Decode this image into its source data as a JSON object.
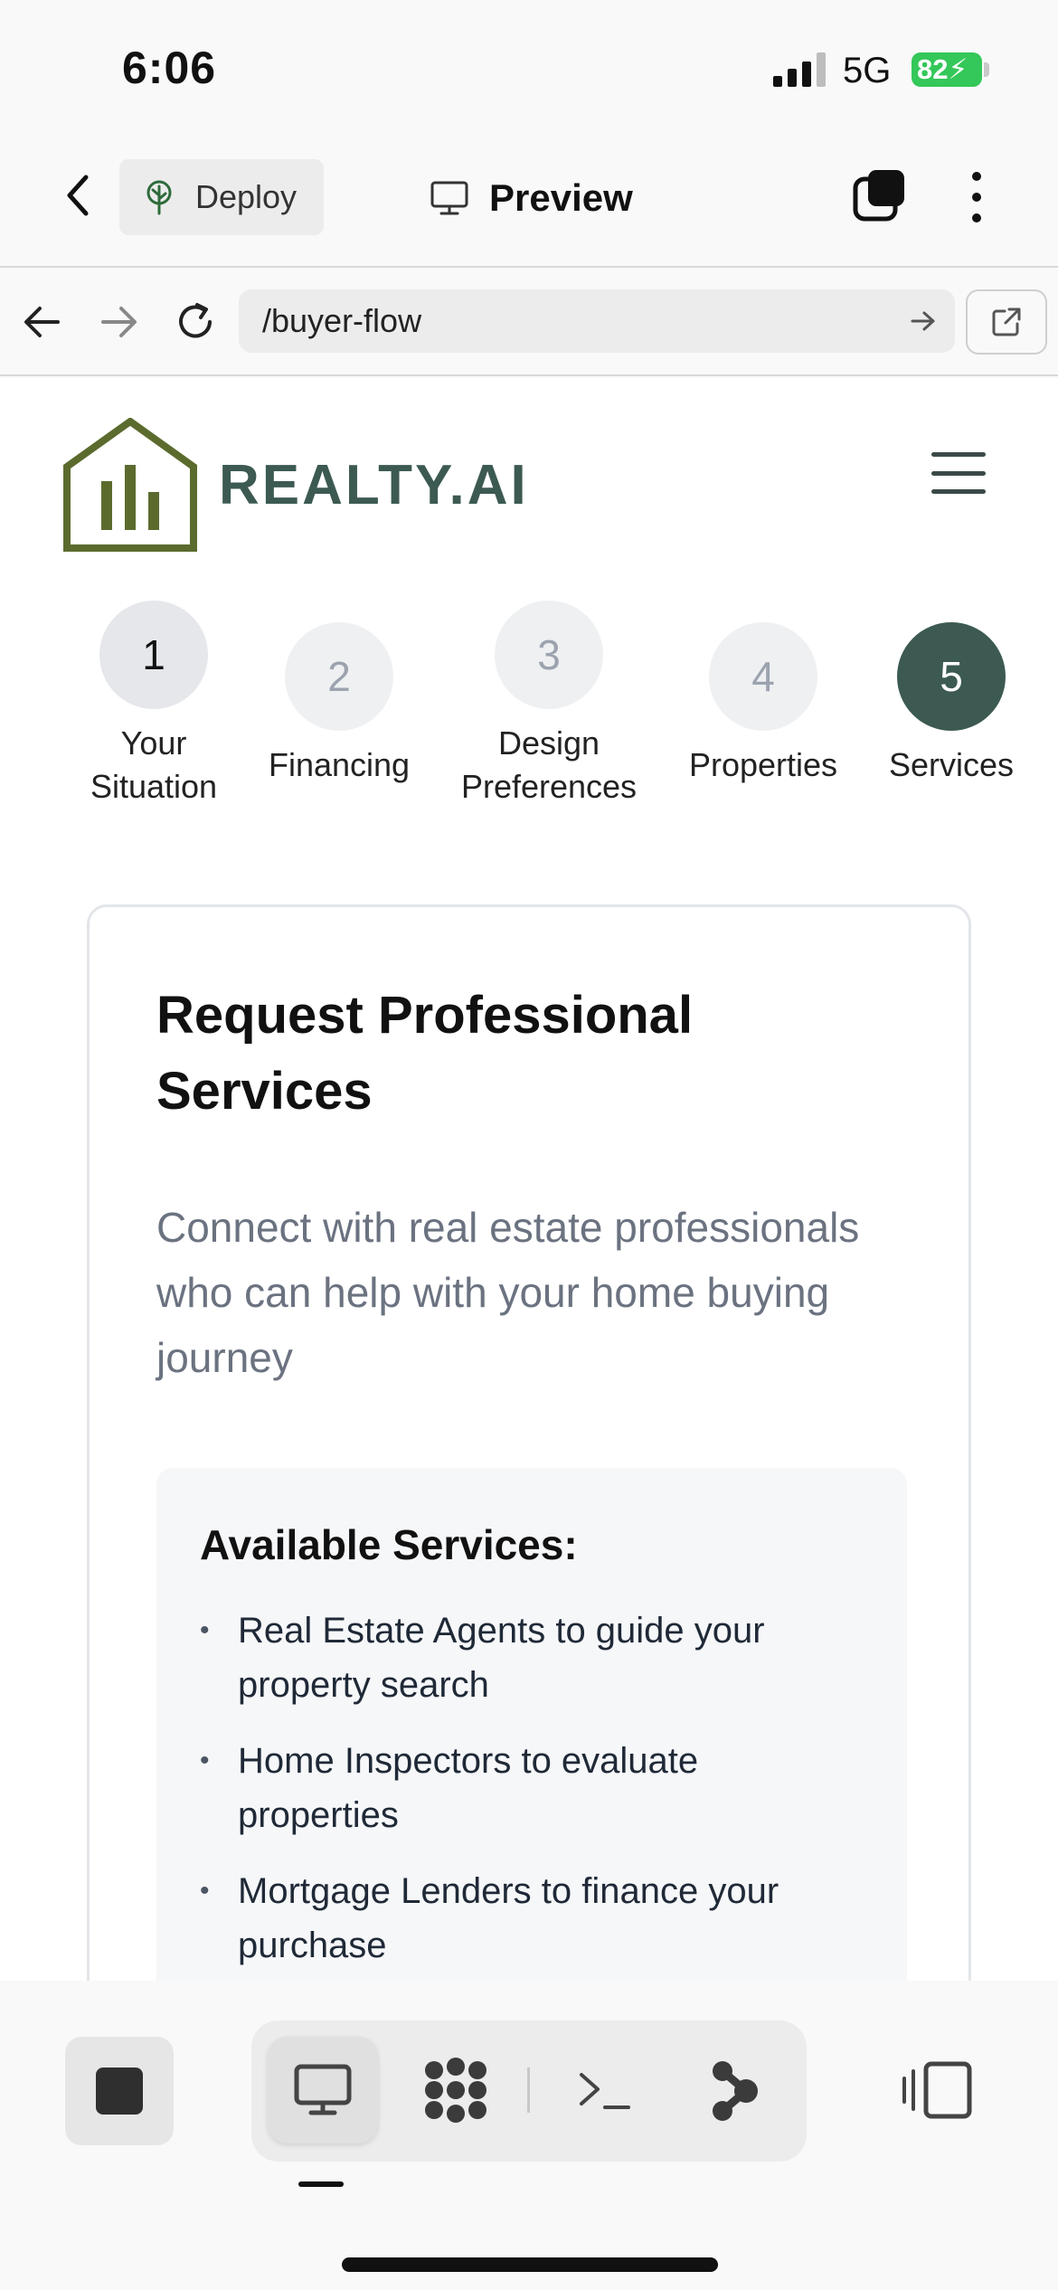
{
  "status_bar": {
    "time": "6:06",
    "network": "5G",
    "battery": "82"
  },
  "app_toolbar": {
    "deploy_label": "Deploy",
    "preview_label": "Preview"
  },
  "url_bar": {
    "path": "/buyer-flow"
  },
  "site": {
    "brand": "REALTY.AI",
    "steps": [
      {
        "number": "1",
        "label_line1": "Your",
        "label_line2": "Situation",
        "state": "visited"
      },
      {
        "number": "2",
        "label_line1": "Financing",
        "label_line2": "",
        "state": "pending"
      },
      {
        "number": "3",
        "label_line1": "Design",
        "label_line2": "Preferences",
        "state": "visited"
      },
      {
        "number": "4",
        "label_line1": "Properties",
        "label_line2": "",
        "state": "pending"
      },
      {
        "number": "5",
        "label_line1": "Services",
        "label_line2": "",
        "state": "active"
      }
    ],
    "card": {
      "title": "Request Professional Services",
      "description": "Connect with real estate professionals who can help with your home buying journey",
      "services_heading": "Available Services:",
      "services": [
        "Real Estate Agents to guide your property search",
        "Home Inspectors to evaluate properties",
        "Mortgage Lenders to finance your purchase"
      ]
    }
  },
  "colors": {
    "brand_green": "#3c5a52",
    "logo_olive": "#5b6b2e",
    "step_active": "#3c5a52",
    "step_visited": "#e5e7eb",
    "step_pending": "#eef0f2",
    "battery_green": "#34c759"
  },
  "icons": {
    "back": "chevron-left-icon",
    "deploy": "tree-icon",
    "preview": "monitor-icon",
    "tabs": "tabs-icon",
    "more": "vertical-dots-icon",
    "nav_back": "arrow-left-icon",
    "nav_forward": "arrow-right-icon",
    "reload": "reload-icon",
    "external": "external-link-icon",
    "menu": "hamburger-icon",
    "stop": "stop-icon",
    "desktop_view": "monitor-icon",
    "grid_view": "dots-grid-icon",
    "terminal": "terminal-icon",
    "share": "graph-icon",
    "device_toggle": "device-toggle-icon"
  }
}
